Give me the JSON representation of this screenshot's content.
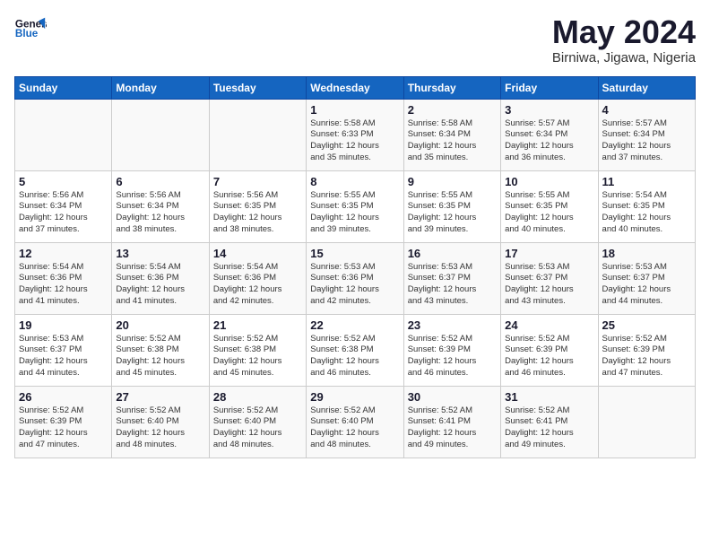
{
  "header": {
    "logo_general": "General",
    "logo_blue": "Blue",
    "month_title": "May 2024",
    "location": "Birniwa, Jigawa, Nigeria"
  },
  "days_of_week": [
    "Sunday",
    "Monday",
    "Tuesday",
    "Wednesday",
    "Thursday",
    "Friday",
    "Saturday"
  ],
  "weeks": [
    [
      {
        "day": "",
        "info": ""
      },
      {
        "day": "",
        "info": ""
      },
      {
        "day": "",
        "info": ""
      },
      {
        "day": "1",
        "info": "Sunrise: 5:58 AM\nSunset: 6:33 PM\nDaylight: 12 hours\nand 35 minutes."
      },
      {
        "day": "2",
        "info": "Sunrise: 5:58 AM\nSunset: 6:34 PM\nDaylight: 12 hours\nand 35 minutes."
      },
      {
        "day": "3",
        "info": "Sunrise: 5:57 AM\nSunset: 6:34 PM\nDaylight: 12 hours\nand 36 minutes."
      },
      {
        "day": "4",
        "info": "Sunrise: 5:57 AM\nSunset: 6:34 PM\nDaylight: 12 hours\nand 37 minutes."
      }
    ],
    [
      {
        "day": "5",
        "info": "Sunrise: 5:56 AM\nSunset: 6:34 PM\nDaylight: 12 hours\nand 37 minutes."
      },
      {
        "day": "6",
        "info": "Sunrise: 5:56 AM\nSunset: 6:34 PM\nDaylight: 12 hours\nand 38 minutes."
      },
      {
        "day": "7",
        "info": "Sunrise: 5:56 AM\nSunset: 6:35 PM\nDaylight: 12 hours\nand 38 minutes."
      },
      {
        "day": "8",
        "info": "Sunrise: 5:55 AM\nSunset: 6:35 PM\nDaylight: 12 hours\nand 39 minutes."
      },
      {
        "day": "9",
        "info": "Sunrise: 5:55 AM\nSunset: 6:35 PM\nDaylight: 12 hours\nand 39 minutes."
      },
      {
        "day": "10",
        "info": "Sunrise: 5:55 AM\nSunset: 6:35 PM\nDaylight: 12 hours\nand 40 minutes."
      },
      {
        "day": "11",
        "info": "Sunrise: 5:54 AM\nSunset: 6:35 PM\nDaylight: 12 hours\nand 40 minutes."
      }
    ],
    [
      {
        "day": "12",
        "info": "Sunrise: 5:54 AM\nSunset: 6:36 PM\nDaylight: 12 hours\nand 41 minutes."
      },
      {
        "day": "13",
        "info": "Sunrise: 5:54 AM\nSunset: 6:36 PM\nDaylight: 12 hours\nand 41 minutes."
      },
      {
        "day": "14",
        "info": "Sunrise: 5:54 AM\nSunset: 6:36 PM\nDaylight: 12 hours\nand 42 minutes."
      },
      {
        "day": "15",
        "info": "Sunrise: 5:53 AM\nSunset: 6:36 PM\nDaylight: 12 hours\nand 42 minutes."
      },
      {
        "day": "16",
        "info": "Sunrise: 5:53 AM\nSunset: 6:37 PM\nDaylight: 12 hours\nand 43 minutes."
      },
      {
        "day": "17",
        "info": "Sunrise: 5:53 AM\nSunset: 6:37 PM\nDaylight: 12 hours\nand 43 minutes."
      },
      {
        "day": "18",
        "info": "Sunrise: 5:53 AM\nSunset: 6:37 PM\nDaylight: 12 hours\nand 44 minutes."
      }
    ],
    [
      {
        "day": "19",
        "info": "Sunrise: 5:53 AM\nSunset: 6:37 PM\nDaylight: 12 hours\nand 44 minutes."
      },
      {
        "day": "20",
        "info": "Sunrise: 5:52 AM\nSunset: 6:38 PM\nDaylight: 12 hours\nand 45 minutes."
      },
      {
        "day": "21",
        "info": "Sunrise: 5:52 AM\nSunset: 6:38 PM\nDaylight: 12 hours\nand 45 minutes."
      },
      {
        "day": "22",
        "info": "Sunrise: 5:52 AM\nSunset: 6:38 PM\nDaylight: 12 hours\nand 46 minutes."
      },
      {
        "day": "23",
        "info": "Sunrise: 5:52 AM\nSunset: 6:39 PM\nDaylight: 12 hours\nand 46 minutes."
      },
      {
        "day": "24",
        "info": "Sunrise: 5:52 AM\nSunset: 6:39 PM\nDaylight: 12 hours\nand 46 minutes."
      },
      {
        "day": "25",
        "info": "Sunrise: 5:52 AM\nSunset: 6:39 PM\nDaylight: 12 hours\nand 47 minutes."
      }
    ],
    [
      {
        "day": "26",
        "info": "Sunrise: 5:52 AM\nSunset: 6:39 PM\nDaylight: 12 hours\nand 47 minutes."
      },
      {
        "day": "27",
        "info": "Sunrise: 5:52 AM\nSunset: 6:40 PM\nDaylight: 12 hours\nand 48 minutes."
      },
      {
        "day": "28",
        "info": "Sunrise: 5:52 AM\nSunset: 6:40 PM\nDaylight: 12 hours\nand 48 minutes."
      },
      {
        "day": "29",
        "info": "Sunrise: 5:52 AM\nSunset: 6:40 PM\nDaylight: 12 hours\nand 48 minutes."
      },
      {
        "day": "30",
        "info": "Sunrise: 5:52 AM\nSunset: 6:41 PM\nDaylight: 12 hours\nand 49 minutes."
      },
      {
        "day": "31",
        "info": "Sunrise: 5:52 AM\nSunset: 6:41 PM\nDaylight: 12 hours\nand 49 minutes."
      },
      {
        "day": "",
        "info": ""
      }
    ]
  ]
}
